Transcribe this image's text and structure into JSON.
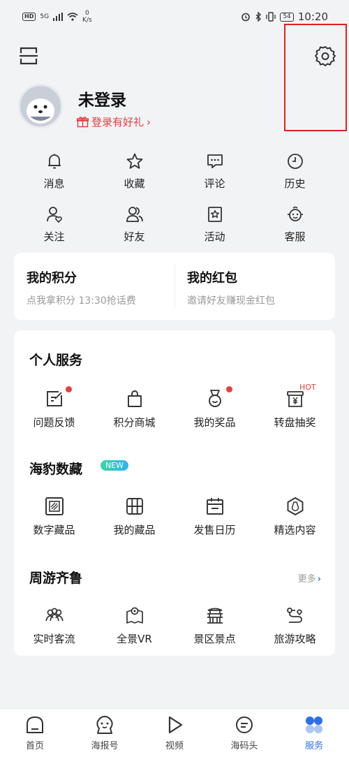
{
  "status_bar": {
    "hd": "HD",
    "signal": "5G",
    "speed_value": "0",
    "speed_unit": "K/s",
    "battery": "54",
    "time": "10:20"
  },
  "profile": {
    "title": "未登录",
    "gift_text": "登录有好礼",
    "gift_arrow": "›"
  },
  "quick_row1": [
    {
      "label": "消息",
      "icon": "bell-icon"
    },
    {
      "label": "收藏",
      "icon": "star-icon"
    },
    {
      "label": "评论",
      "icon": "comment-icon"
    },
    {
      "label": "历史",
      "icon": "clock-icon"
    }
  ],
  "quick_row2": [
    {
      "label": "关注",
      "icon": "follow-icon"
    },
    {
      "label": "好友",
      "icon": "friends-icon"
    },
    {
      "label": "活动",
      "icon": "activity-icon"
    },
    {
      "label": "客服",
      "icon": "service-icon"
    }
  ],
  "points": {
    "title": "我的积分",
    "subtitle": "点我拿积分 13:30抢话费"
  },
  "red_packet": {
    "title": "我的红包",
    "subtitle": "邀请好友赚现金红包"
  },
  "personal_services": {
    "title": "个人服务",
    "items": [
      {
        "label": "问题反馈",
        "icon": "feedback-icon",
        "dot": true
      },
      {
        "label": "积分商城",
        "icon": "shopping-bag-icon"
      },
      {
        "label": "我的奖品",
        "icon": "medal-icon",
        "dot": true
      },
      {
        "label": "转盘抽奖",
        "icon": "lottery-icon",
        "tag": "HOT"
      }
    ]
  },
  "digital_collections": {
    "title": "海豹数藏",
    "badge": "NEW",
    "items": [
      {
        "label": "数字藏品",
        "icon": "digital-collection-icon"
      },
      {
        "label": "我的藏品",
        "icon": "grid-collection-icon"
      },
      {
        "label": "发售日历",
        "icon": "calendar-icon"
      },
      {
        "label": "精选内容",
        "icon": "featured-icon"
      }
    ]
  },
  "travel": {
    "title": "周游齐鲁",
    "more": "更多",
    "more_arrow": "›",
    "items": [
      {
        "label": "实时客流",
        "icon": "crowd-icon"
      },
      {
        "label": "全景VR",
        "icon": "vr-map-icon"
      },
      {
        "label": "景区景点",
        "icon": "pavilion-icon"
      },
      {
        "label": "旅游攻略",
        "icon": "route-icon"
      }
    ]
  },
  "bottom_nav": [
    {
      "label": "首页",
      "icon": "home-icon"
    },
    {
      "label": "海报号",
      "icon": "seal-icon"
    },
    {
      "label": "视频",
      "icon": "play-icon"
    },
    {
      "label": "海码头",
      "icon": "chat-icon"
    },
    {
      "label": "服务",
      "icon": "services-icon",
      "active": true
    }
  ],
  "colors": {
    "accent": "#2d6fe6",
    "alert": "#e8403c",
    "highlight_box": "#e02020"
  }
}
